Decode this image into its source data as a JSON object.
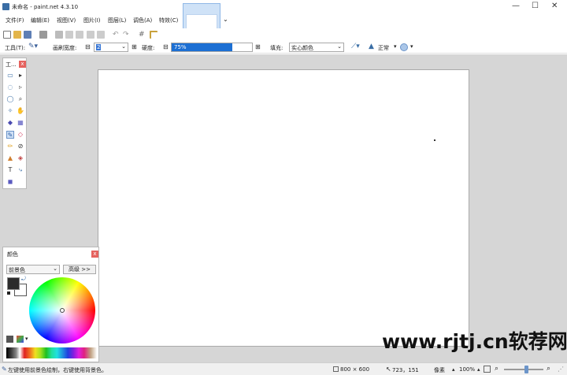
{
  "window": {
    "title": "未命名 - paint.net 4.3.10",
    "minimize": "—",
    "maximize": "☐",
    "close": "✕"
  },
  "menu": {
    "items": [
      "文件(F)",
      "编辑(E)",
      "视图(V)",
      "图片(I)",
      "图层(L)",
      "调色(A)",
      "特效(C)"
    ]
  },
  "toolbar2": {
    "tool_label": "工具(T):",
    "brush_width_label": "画刷宽度:",
    "brush_width_value": "2",
    "hardness_label": "硬度:",
    "hardness_value": "75%",
    "hardness_fraction": 0.75,
    "fill_label": "填充:",
    "fill_value": "实心颜色",
    "blend_value": "正常"
  },
  "tools_panel": {
    "title": "工...",
    "close": "x",
    "items": [
      {
        "name": "rectangle-select-icon",
        "glyph": "▭"
      },
      {
        "name": "move-selection-icon",
        "glyph": "▸"
      },
      {
        "name": "lasso-select-icon",
        "glyph": "◌"
      },
      {
        "name": "move-selected-icon",
        "glyph": "▹"
      },
      {
        "name": "ellipse-select-icon",
        "glyph": "◯"
      },
      {
        "name": "zoom-icon",
        "glyph": "⌕"
      },
      {
        "name": "magic-wand-icon",
        "glyph": "✧"
      },
      {
        "name": "pan-hand-icon",
        "glyph": "✋"
      },
      {
        "name": "paint-bucket-icon",
        "glyph": "◆"
      },
      {
        "name": "gradient-icon",
        "glyph": "▦"
      },
      {
        "name": "paintbrush-icon",
        "glyph": "✎"
      },
      {
        "name": "eraser-icon",
        "glyph": "◇"
      },
      {
        "name": "pencil-icon",
        "glyph": "✏"
      },
      {
        "name": "color-picker-icon",
        "glyph": "⊘"
      },
      {
        "name": "clone-stamp-icon",
        "glyph": "▲"
      },
      {
        "name": "recolor-icon",
        "glyph": "◈"
      },
      {
        "name": "text-icon",
        "glyph": "T"
      },
      {
        "name": "line-curve-icon",
        "glyph": "⤷"
      },
      {
        "name": "shapes-icon",
        "glyph": "◼"
      }
    ]
  },
  "colors_panel": {
    "title": "颜色",
    "close": "x",
    "selector_value": "前景色",
    "more_button": "高级 >>",
    "primary_color": "#2b2b2b",
    "secondary_color": "#ffffff"
  },
  "status": {
    "hint": "左键使用前景色绘制，右键使用背景色。",
    "image_size": "800 × 600",
    "cursor_pos": "723，151",
    "units": "像素",
    "zoom": "100%"
  },
  "watermark": "www.rjtj.cn软荐网"
}
